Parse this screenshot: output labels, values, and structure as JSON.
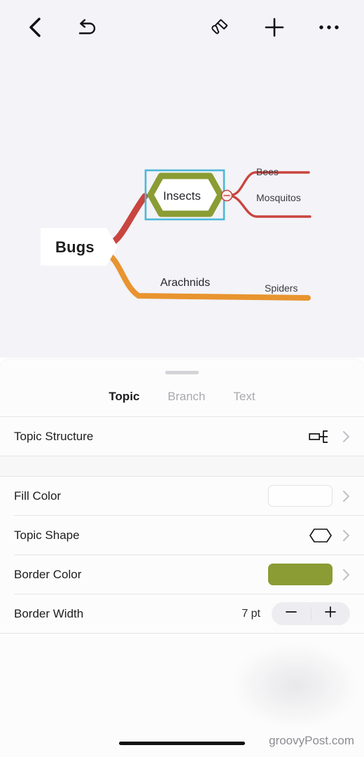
{
  "toolbar": {
    "back_icon": "chevron-left-icon",
    "undo_icon": "undo-arrow-icon",
    "brush_icon": "paint-roller-icon",
    "add_icon": "plus-icon",
    "more_icon": "ellipsis-icon"
  },
  "canvas": {
    "background_color": "#F3F3F8",
    "nodes": {
      "root": "Bugs",
      "insects": "Insects",
      "bees": "Bees",
      "mosquitos": "Mosquitos",
      "arachnids": "Arachnids",
      "spiders": "Spiders"
    },
    "colors": {
      "branch_red": "#C9453F",
      "branch_orange": "#E8942F",
      "topic_border": "#8A9C33",
      "selection": "#4BB8D8",
      "collapse_button": "#C9453F"
    },
    "collapse_button_icon": "minus-circle-icon"
  },
  "sheet": {
    "tabs": [
      {
        "label": "Topic",
        "active": true
      },
      {
        "label": "Branch",
        "active": false
      },
      {
        "label": "Text",
        "active": false
      }
    ],
    "rows": {
      "topic_structure": {
        "label": "Topic Structure",
        "icon": "topic-structure-icon"
      },
      "fill_color": {
        "label": "Fill Color",
        "swatch_color": "#FEFEFE"
      },
      "topic_shape": {
        "label": "Topic Shape",
        "icon": "hexagon-icon"
      },
      "border_color": {
        "label": "Border Color",
        "swatch_color": "#8A9C33"
      },
      "border_width": {
        "label": "Border Width",
        "value": "7 pt",
        "decrement_icon": "minus-icon",
        "increment_icon": "plus-icon"
      }
    }
  },
  "footer": {
    "watermark": "groovyPost.com"
  }
}
